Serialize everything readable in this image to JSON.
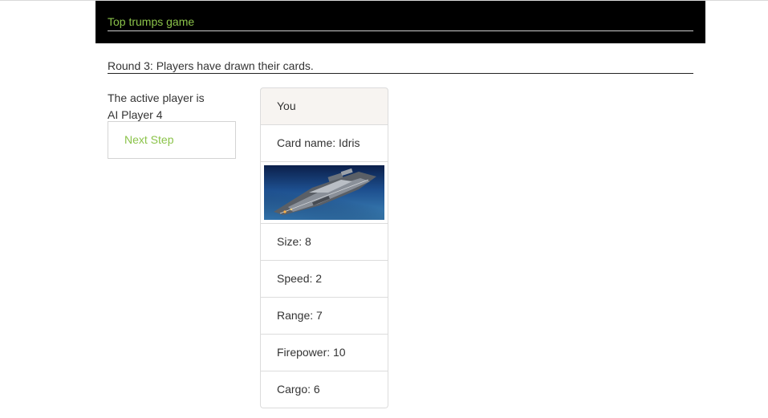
{
  "navbar": {
    "brand": "Top trumps game"
  },
  "round": {
    "status": "Round 3: Players have drawn their cards."
  },
  "active_player": {
    "label": "The active player is",
    "name": "AI Player 4"
  },
  "controls": {
    "next_step_label": "Next Step"
  },
  "card": {
    "owner": "You",
    "name": "Card name: Idris",
    "image_icon": "spaceship-image",
    "stats": [
      "Size: 8",
      "Speed: 2",
      "Range: 7",
      "Firepower: 10",
      "Cargo: 6"
    ]
  },
  "colors": {
    "navbar_bg": "#000000",
    "accent_green": "#8bc34a",
    "card_header_bg": "#f7f4f1"
  }
}
